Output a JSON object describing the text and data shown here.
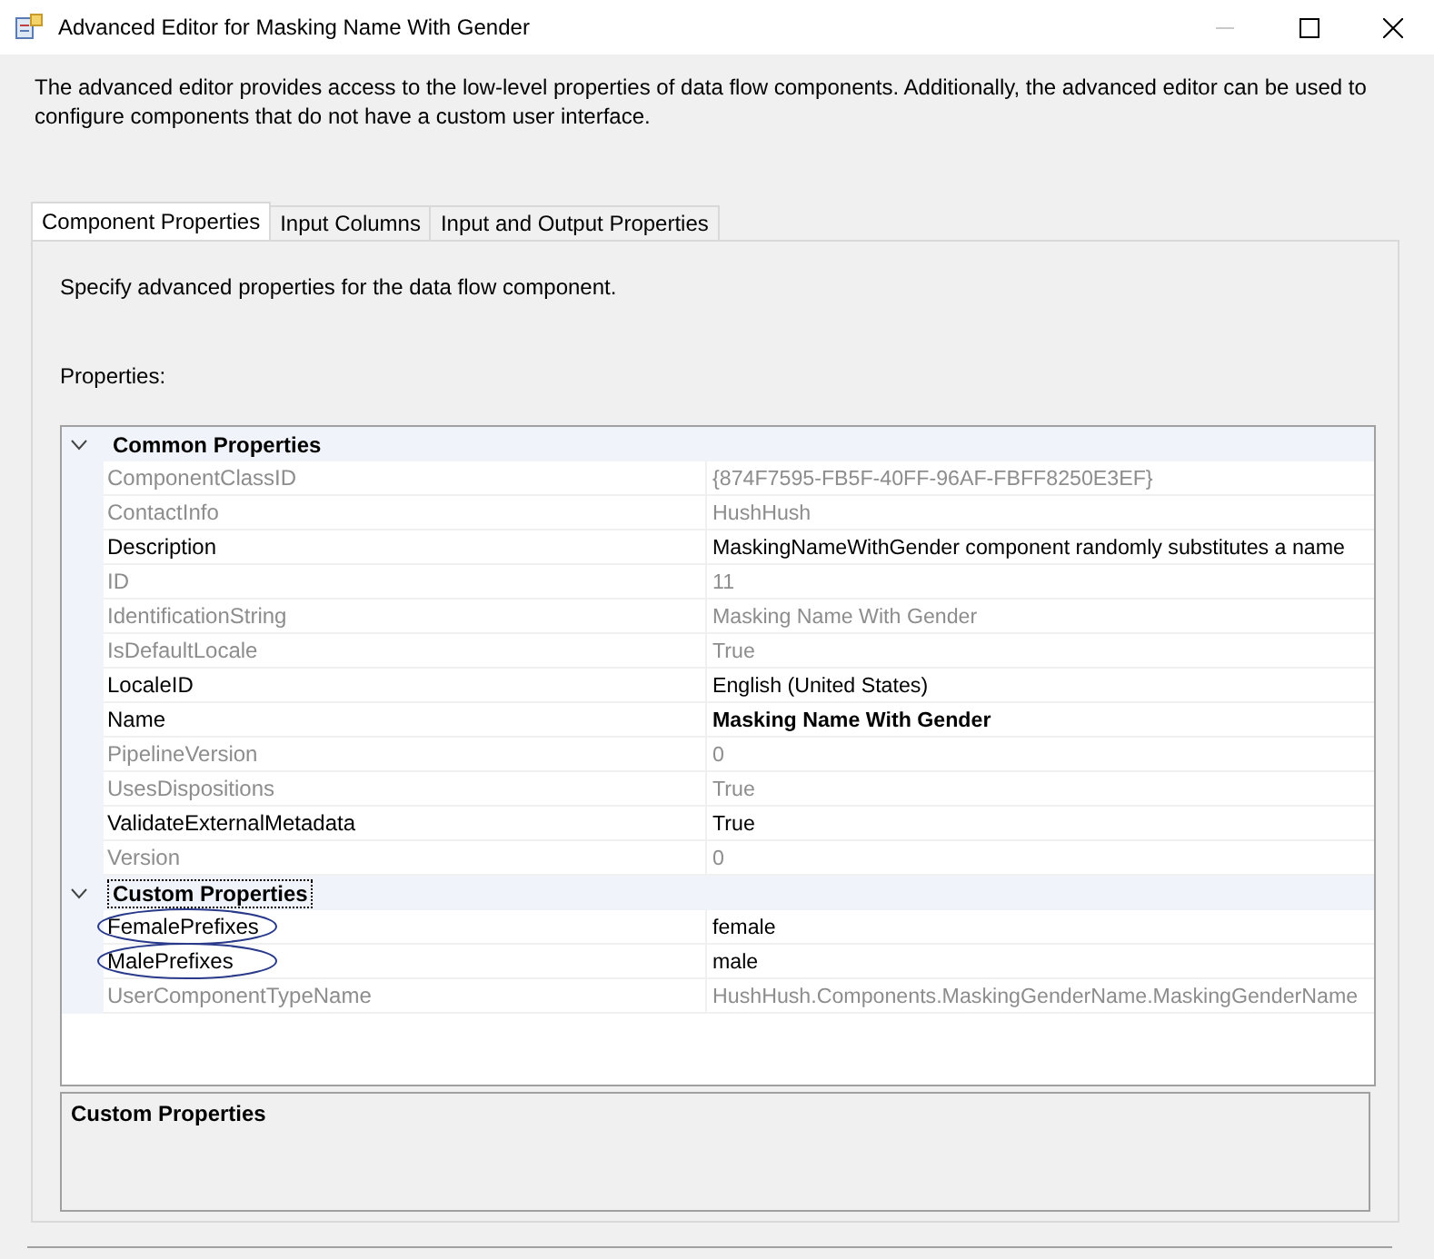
{
  "window": {
    "title": "Advanced Editor for Masking Name With Gender"
  },
  "intro": "The advanced editor provides access to the low-level properties of data flow components. Additionally, the advanced editor can be used to configure components that do not have a custom user interface.",
  "tabs": [
    {
      "label": "Component Properties",
      "selected": true
    },
    {
      "label": "Input Columns",
      "selected": false
    },
    {
      "label": "Input and Output Properties",
      "selected": false
    }
  ],
  "panel": {
    "hint": "Specify advanced properties for the data flow component.",
    "properties_label": "Properties:"
  },
  "grid": {
    "categories": [
      {
        "name": "Common Properties",
        "expanded": true,
        "selected": false,
        "rows": [
          {
            "name": "ComponentClassID",
            "value": "{874F7595-FB5F-40FF-96AF-FBFF8250E3EF}",
            "readonly": true,
            "modified": false,
            "circled": false
          },
          {
            "name": "ContactInfo",
            "value": "HushHush",
            "readonly": true,
            "modified": false,
            "circled": false
          },
          {
            "name": "Description",
            "value": "MaskingNameWithGender component randomly substitutes a name",
            "readonly": false,
            "modified": false,
            "circled": false
          },
          {
            "name": "ID",
            "value": "11",
            "readonly": true,
            "modified": false,
            "circled": false
          },
          {
            "name": "IdentificationString",
            "value": "Masking Name With Gender",
            "readonly": true,
            "modified": false,
            "circled": false
          },
          {
            "name": "IsDefaultLocale",
            "value": "True",
            "readonly": true,
            "modified": false,
            "circled": false
          },
          {
            "name": "LocaleID",
            "value": "English (United States)",
            "readonly": false,
            "modified": false,
            "circled": false
          },
          {
            "name": "Name",
            "value": "Masking Name With Gender",
            "readonly": false,
            "modified": true,
            "circled": false
          },
          {
            "name": "PipelineVersion",
            "value": "0",
            "readonly": true,
            "modified": false,
            "circled": false
          },
          {
            "name": "UsesDispositions",
            "value": "True",
            "readonly": true,
            "modified": false,
            "circled": false
          },
          {
            "name": "ValidateExternalMetadata",
            "value": "True",
            "readonly": false,
            "modified": false,
            "circled": false
          },
          {
            "name": "Version",
            "value": "0",
            "readonly": true,
            "modified": false,
            "circled": false
          }
        ]
      },
      {
        "name": "Custom Properties",
        "expanded": true,
        "selected": true,
        "rows": [
          {
            "name": "FemalePrefixes",
            "value": "female",
            "readonly": false,
            "modified": false,
            "circled": true
          },
          {
            "name": "MalePrefixes",
            "value": "male",
            "readonly": false,
            "modified": false,
            "circled": true
          },
          {
            "name": "UserComponentTypeName",
            "value": "HushHush.Components.MaskingGenderName.MaskingGenderName",
            "readonly": true,
            "modified": false,
            "circled": false
          }
        ]
      }
    ]
  },
  "description_pane": {
    "title": "Custom Properties"
  }
}
